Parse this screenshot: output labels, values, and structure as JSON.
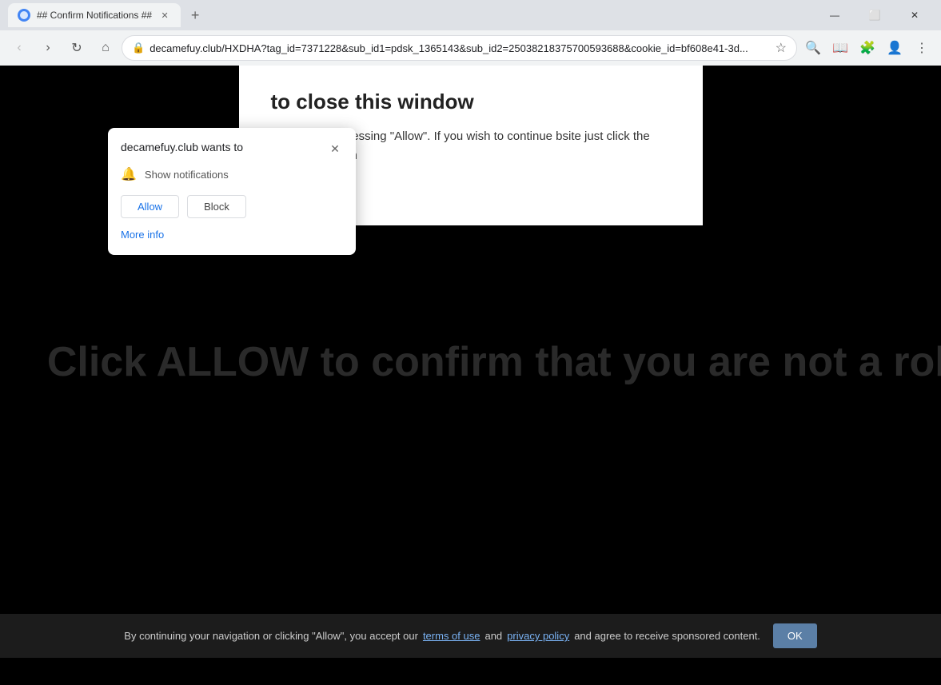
{
  "browser": {
    "title_bar": {
      "tab_title": "## Confirm Notifications ##",
      "close_label": "✕",
      "minimize_label": "—",
      "maximize_label": "⬜"
    },
    "address_bar": {
      "url": "decamefuy.club/HXDHA?tag_id=7371228&sub_id1=pdsk_1365143&sub_id2=25038218375700593688&cookie_id=bf608e41-3d...",
      "lock_icon": "🔒"
    },
    "new_tab_label": "+"
  },
  "notification_popup": {
    "site_name": "decamefuy.club wants to",
    "notification_label": "Show notifications",
    "allow_label": "Allow",
    "block_label": "Block",
    "more_info_label": "More info",
    "close_label": "✕"
  },
  "page": {
    "card_title": "to close this window",
    "card_text": "be closed by pressing \"Allow\". If you wish to continue bsite just click the more info button",
    "robot_text": "Click ALLOW to confirm that you are not a robot!",
    "bottom_text_before": "By continuing your navigation or clicking \"Allow\", you accept our",
    "terms_label": "terms of use",
    "and_label": "and",
    "privacy_label": "privacy policy",
    "bottom_text_after": "and agree to receive sponsored content.",
    "ok_label": "OK"
  },
  "icons": {
    "back": "‹",
    "forward": "›",
    "reload": "↻",
    "home": "⌂",
    "search": "🔍",
    "extensions": "🧩",
    "profile": "👤",
    "menu": "⋮",
    "star": "☆",
    "bell": "🔔"
  }
}
